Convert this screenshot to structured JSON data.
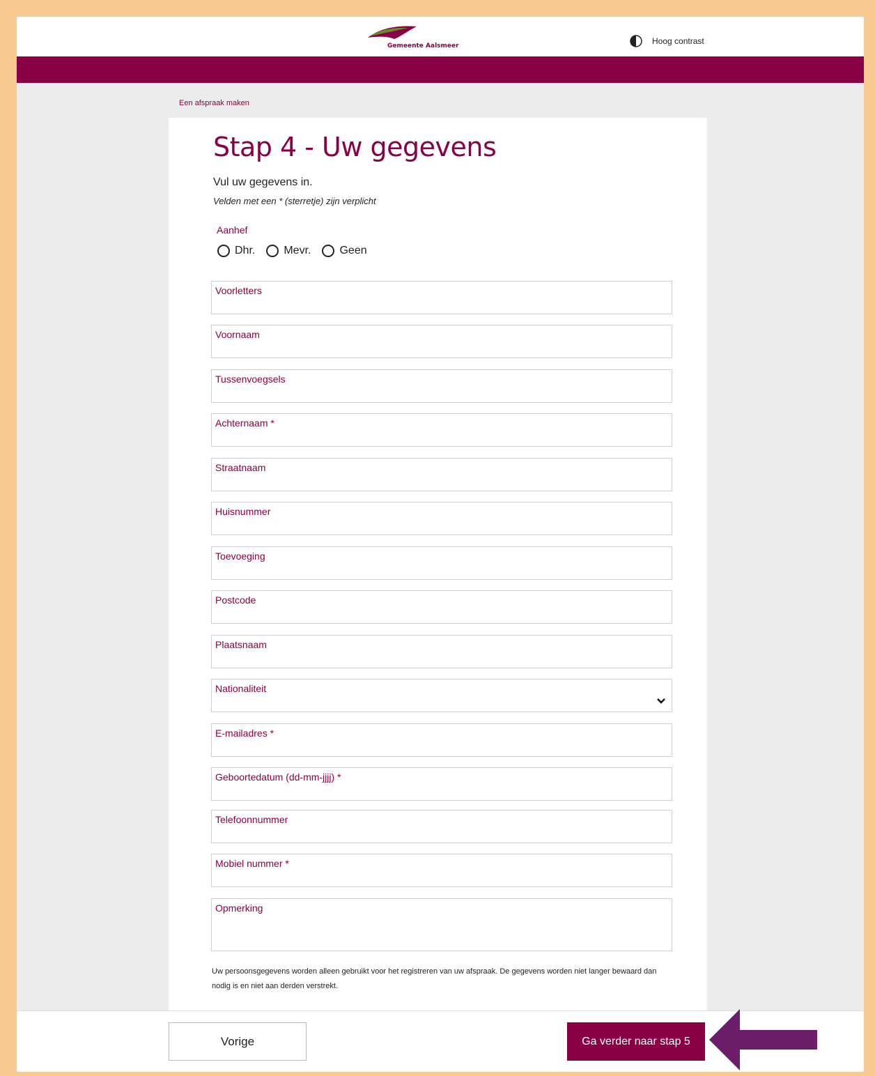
{
  "header": {
    "logo_text": "Gemeente Aalsmeer",
    "contrast_label": "Hoog contrast"
  },
  "breadcrumb": "Een afspraak maken",
  "form": {
    "title": "Stap 4 - Uw gegevens",
    "intro": "Vul uw gegevens in.",
    "required_note": "Velden met een * (sterretje) zijn verplicht",
    "aanhef_label": "Aanhef",
    "aanhef_options": [
      "Dhr.",
      "Mevr.",
      "Geen"
    ],
    "fields": [
      "Voorletters",
      "Voornaam",
      "Tussenvoegsels",
      "Achternaam *",
      "Straatnaam",
      "Huisnummer",
      "Toevoeging",
      "Postcode",
      "Plaatsnaam",
      "Nationaliteit",
      "E-mailadres *",
      "Geboortedatum (dd-mm-jjjj) *",
      "Telefoonnummer",
      "Mobiel nummer *",
      "Opmerking"
    ],
    "privacy_text": "Uw persoonsgegevens worden alleen gebruikt voor het registreren van uw afspraak. De gegevens worden niet langer bewaard dan nodig is en niet aan derden verstrekt."
  },
  "footer": {
    "prev_label": "Vorige",
    "next_label": "Ga verder naar stap 5"
  },
  "colors": {
    "brand": "#8a0046",
    "outer_border": "#f8c993",
    "arrow": "#6b1d6a"
  },
  "icons": [
    "half-circle-contrast-icon",
    "chevron-down-icon",
    "arrow-left-pointer-icon"
  ]
}
